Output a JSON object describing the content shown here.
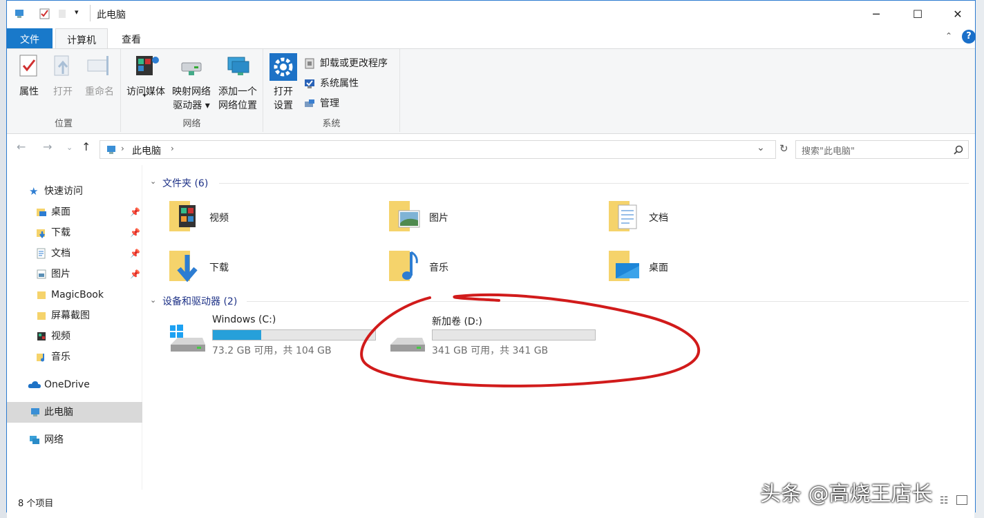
{
  "window": {
    "title": "此电脑"
  },
  "tabs": {
    "file": "文件",
    "computer": "计算机",
    "view": "查看"
  },
  "ribbon": {
    "location": {
      "label": "位置",
      "properties": "属性",
      "open": "打开",
      "rename": "重命名"
    },
    "network": {
      "label": "网络",
      "media": "访问媒体",
      "map_drive_1": "映射网络",
      "map_drive_2": "驱动器",
      "add_loc_1": "添加一个",
      "add_loc_2": "网络位置"
    },
    "system": {
      "label": "系统",
      "open_settings_1": "打开",
      "open_settings_2": "设置",
      "uninstall": "卸载或更改程序",
      "sys_props": "系统属性",
      "manage": "管理"
    }
  },
  "address": {
    "path": "此电脑",
    "search_placeholder": "搜索\"此电脑\""
  },
  "sidebar": {
    "quick_access": "快速访问",
    "items": [
      {
        "label": "桌面",
        "pinned": true
      },
      {
        "label": "下载",
        "pinned": true
      },
      {
        "label": "文档",
        "pinned": true
      },
      {
        "label": "图片",
        "pinned": true
      },
      {
        "label": "MagicBook",
        "pinned": false
      },
      {
        "label": "屏幕截图",
        "pinned": false
      },
      {
        "label": "视频",
        "pinned": false
      },
      {
        "label": "音乐",
        "pinned": false
      }
    ],
    "onedrive": "OneDrive",
    "this_pc": "此电脑",
    "network": "网络"
  },
  "content": {
    "folders_header": "文件夹 (6)",
    "folders": [
      "视频",
      "图片",
      "文档",
      "下载",
      "音乐",
      "桌面"
    ],
    "drives_header": "设备和驱动器 (2)",
    "drives": [
      {
        "name": "Windows (C:)",
        "size": "73.2 GB 可用，共 104 GB",
        "used_fraction": 0.296
      },
      {
        "name": "新加卷 (D:)",
        "size": "341 GB 可用，共 341 GB",
        "used_fraction": 0.0
      }
    ]
  },
  "status": {
    "items": "8 个项目"
  },
  "watermark": "头条 @高烧王店长",
  "colors": {
    "accent": "#1979ca",
    "drive_fill": "#26a0da",
    "annotation": "#d11b1b"
  }
}
